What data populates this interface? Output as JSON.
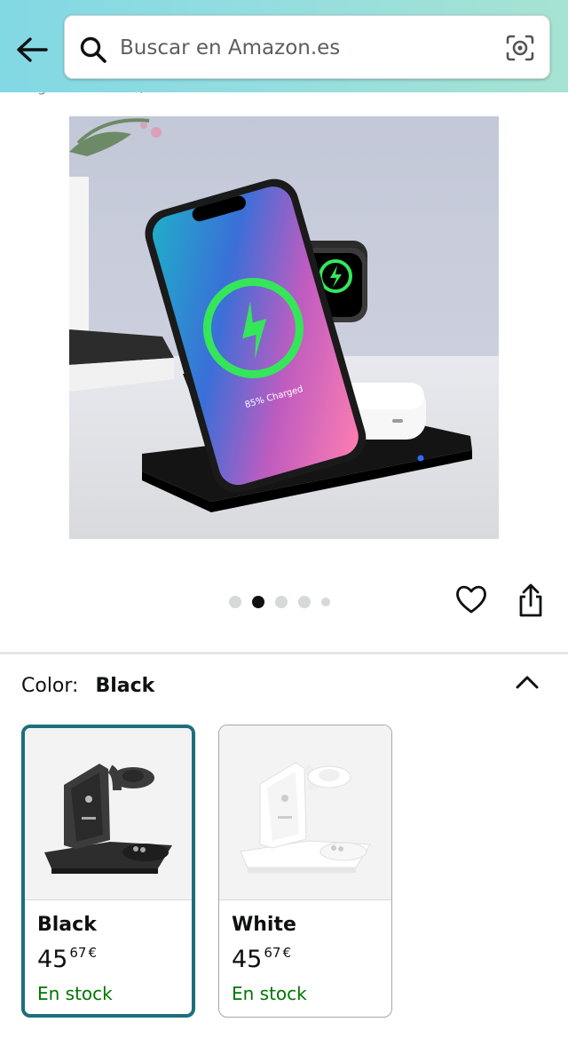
{
  "header": {
    "back_icon": "arrow-left-icon",
    "search": {
      "placeholder": "Buscar en Amazon.es",
      "search_icon": "search-icon",
      "camera_icon": "camera-lens-icon"
    },
    "colors": {
      "gradient_left": "#82d8e3",
      "gradient_right": "#a6e3d2"
    }
  },
  "breadcrumb_peek": "Seguro Y Estable,Black",
  "product_image": {
    "screen_text": "85% Charged"
  },
  "carousel": {
    "dot_count": 5,
    "active_index": 1
  },
  "actions": {
    "wishlist_icon": "heart-icon",
    "share_icon": "share-icon"
  },
  "color_selector": {
    "label": "Color:",
    "selected": "Black",
    "collapse_icon": "chevron-up-icon",
    "options": [
      {
        "name": "Black",
        "price_whole": "45",
        "price_fraction": "67",
        "currency": "€",
        "availability": "En stock",
        "selected": true
      },
      {
        "name": "White",
        "price_whole": "45",
        "price_fraction": "67",
        "currency": "€",
        "availability": "En stock",
        "selected": false
      }
    ]
  },
  "theme": {
    "selected_border": "#1c6e7d",
    "in_stock_color": "#007600"
  }
}
